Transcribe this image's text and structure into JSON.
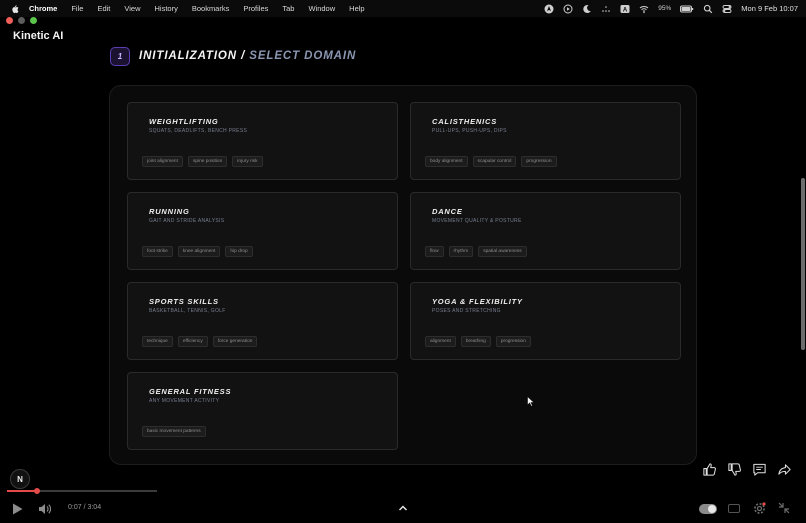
{
  "menubar": {
    "items": [
      "Chrome",
      "File",
      "Edit",
      "View",
      "History",
      "Bookmarks",
      "Profiles",
      "Tab",
      "Window",
      "Help"
    ],
    "battery": "95%",
    "clock": "Mon 9 Feb  10:07"
  },
  "app": {
    "brand": "Kinetic AI"
  },
  "heading": {
    "step": "1",
    "main": "INITIALIZATION / ",
    "sub": "SELECT DOMAIN"
  },
  "domains": [
    {
      "title": "WEIGHTLIFTING",
      "subtitle": "SQUATS, DEADLIFTS, BENCH PRESS",
      "tags": [
        "joint alignment",
        "spine position",
        "injury risk"
      ]
    },
    {
      "title": "CALISTHENICS",
      "subtitle": "PULL-UPS, PUSH-UPS, DIPS",
      "tags": [
        "body alignment",
        "scapular control",
        "progression"
      ]
    },
    {
      "title": "RUNNING",
      "subtitle": "GAIT AND STRIDE ANALYSIS",
      "tags": [
        "foot strike",
        "knee alignment",
        "hip drop"
      ]
    },
    {
      "title": "DANCE",
      "subtitle": "MOVEMENT QUALITY & POSTURE",
      "tags": [
        "flow",
        "rhythm",
        "spatial awareness"
      ]
    },
    {
      "title": "SPORTS SKILLS",
      "subtitle": "BASKETBALL, TENNIS, GOLF",
      "tags": [
        "technique",
        "efficiency",
        "force generation"
      ]
    },
    {
      "title": "YOGA & FLEXIBILITY",
      "subtitle": "POSES AND STRETCHING",
      "tags": [
        "alignment",
        "breathing",
        "progression"
      ]
    },
    {
      "title": "GENERAL FITNESS",
      "subtitle": "ANY MOVEMENT ACTIVITY",
      "tags": [
        "basic movement patterns"
      ]
    }
  ],
  "avatar": {
    "letter": "N"
  },
  "video": {
    "time": "0:07 / 3:04",
    "progress_fraction": 0.2
  },
  "colors": {
    "accent": "#5a3fb0",
    "progress": "#e34b4b",
    "subheading": "#8a96b2"
  }
}
